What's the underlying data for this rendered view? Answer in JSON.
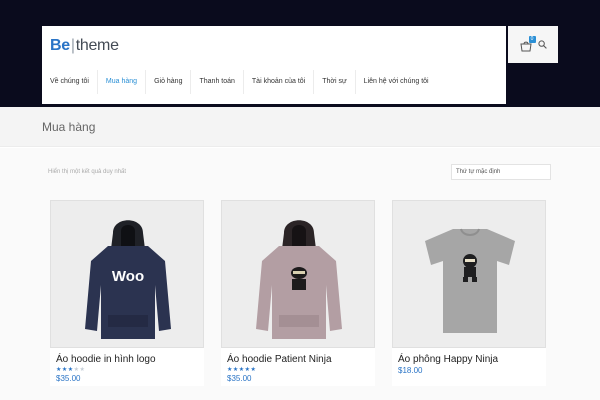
{
  "brand": {
    "part1": "Be",
    "separator": "|",
    "part2": "theme"
  },
  "nav": [
    {
      "label": "Về chúng tôi",
      "active": false
    },
    {
      "label": "Mua hàng",
      "active": true
    },
    {
      "label": "Giỏ hàng",
      "active": false
    },
    {
      "label": "Thanh toán",
      "active": false
    },
    {
      "label": "Tài khoản của tôi",
      "active": false
    },
    {
      "label": "Thời sự",
      "active": false
    },
    {
      "label": "Liên hệ với chúng tôi",
      "active": false
    }
  ],
  "cart": {
    "count": "0"
  },
  "page": {
    "title": "Mua hàng",
    "result_count": "Hiển thị một kết quả duy nhất",
    "sort_label": "Thứ tự mặc định"
  },
  "products": [
    {
      "title": "Áo hoodie in hình logo",
      "price": "$35.00",
      "rating": 3,
      "image": "navy-hoodie-woo",
      "color": "#2b3350"
    },
    {
      "title": "Áo hoodie Patient Ninja",
      "price": "$35.00",
      "rating": 5,
      "image": "pink-hoodie-ninja",
      "color": "#b39ea3"
    },
    {
      "title": "Áo phông Happy Ninja",
      "price": "$18.00",
      "rating": 0,
      "image": "grey-tshirt-ninja",
      "color": "#a6a6a6"
    }
  ],
  "colors": {
    "accent": "#2a8fd5",
    "brand": "#2a74c6",
    "top_bg": "#0a0b1d"
  }
}
